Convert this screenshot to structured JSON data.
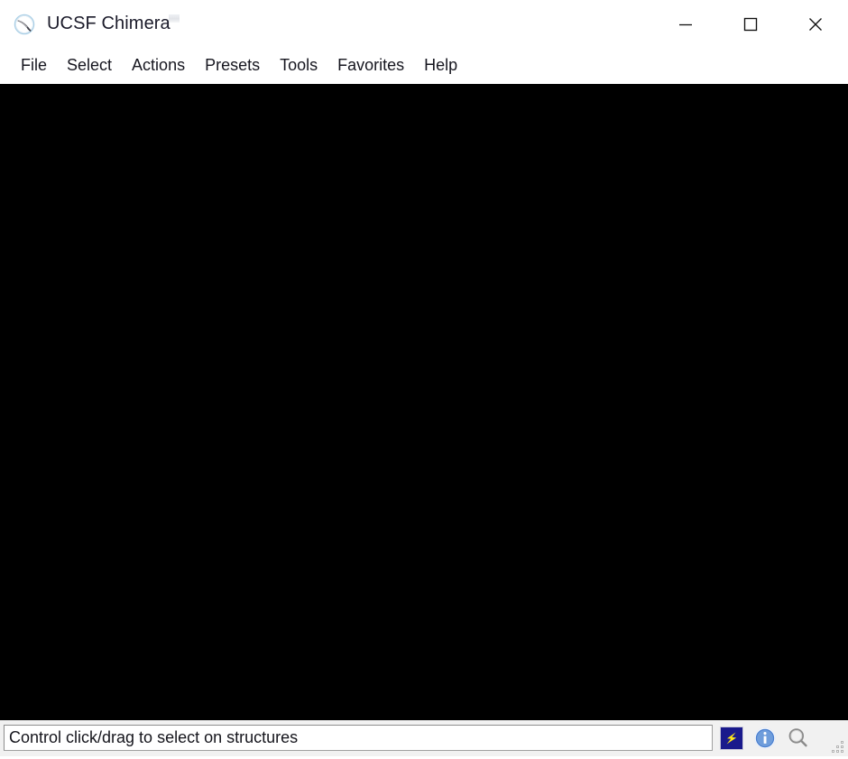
{
  "window": {
    "title": "UCSF Chimera",
    "icon": "chimera-logo-icon",
    "controls": {
      "minimize": {
        "name": "minimize-button",
        "glyph": "minimize-icon",
        "tooltip": "Minimize"
      },
      "maximize": {
        "name": "maximize-button",
        "glyph": "maximize-icon",
        "tooltip": "Maximize"
      },
      "close": {
        "name": "close-button",
        "glyph": "close-icon",
        "tooltip": "Close"
      }
    }
  },
  "menu": {
    "items": [
      {
        "label": "File"
      },
      {
        "label": "Select"
      },
      {
        "label": "Actions"
      },
      {
        "label": "Presets"
      },
      {
        "label": "Tools"
      },
      {
        "label": "Favorites"
      },
      {
        "label": "Help"
      }
    ]
  },
  "viewport": {
    "background_color": "#000000",
    "content": ""
  },
  "status_bar": {
    "message": "Control click/drag to select on structures",
    "icons": [
      {
        "name": "lightning-bolt-icon",
        "semantic": "rapid-access-icon",
        "color": "#ffe81a",
        "background": "#1a1a8c"
      },
      {
        "name": "info-icon",
        "semantic": "status-info-icon",
        "color": "#ffffff",
        "background": "#4a7fd0"
      },
      {
        "name": "magnifier-icon",
        "semantic": "search-icon",
        "color": "#8a8a8a"
      }
    ],
    "resize_grip": "resize-grip-icon"
  },
  "colors": {
    "title_bar_bg": "#ffffff",
    "menu_bar_bg": "#ffffff",
    "text": "#16161f",
    "viewport_bg": "#000000",
    "status_bar_bg": "#f1f1f1",
    "status_field_bg": "#ffffff",
    "status_field_border": "#a0a0a0"
  }
}
